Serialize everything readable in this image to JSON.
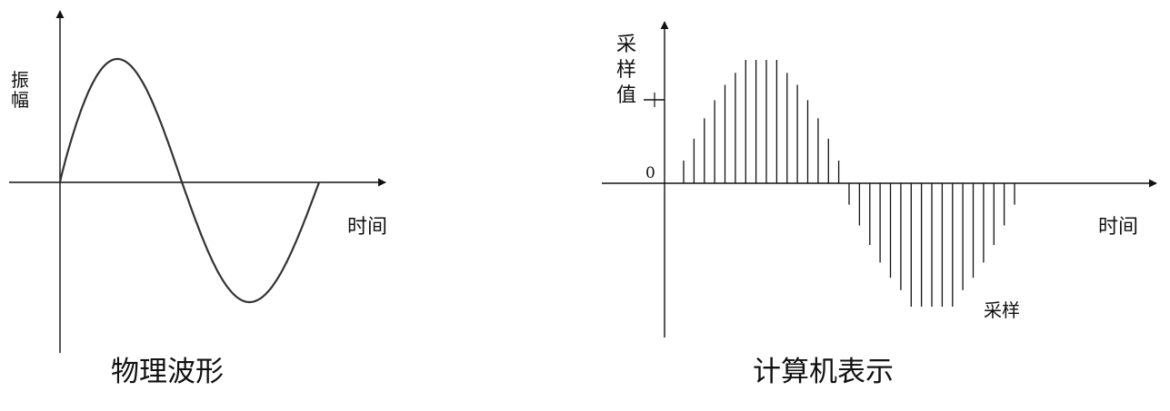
{
  "left_diagram": {
    "title": "物理波形",
    "y_label": "振幅",
    "x_label": "时间"
  },
  "right_diagram": {
    "title": "计算机表示",
    "y_label": "采样值",
    "x_label": "时间",
    "zero_label": "0",
    "sample_label": "采样"
  },
  "chart_data": {
    "type": "sampled_waveform",
    "waveform": "sine",
    "cycles": 1,
    "sample_count": 33,
    "samples_per_half_cycle": 16
  }
}
